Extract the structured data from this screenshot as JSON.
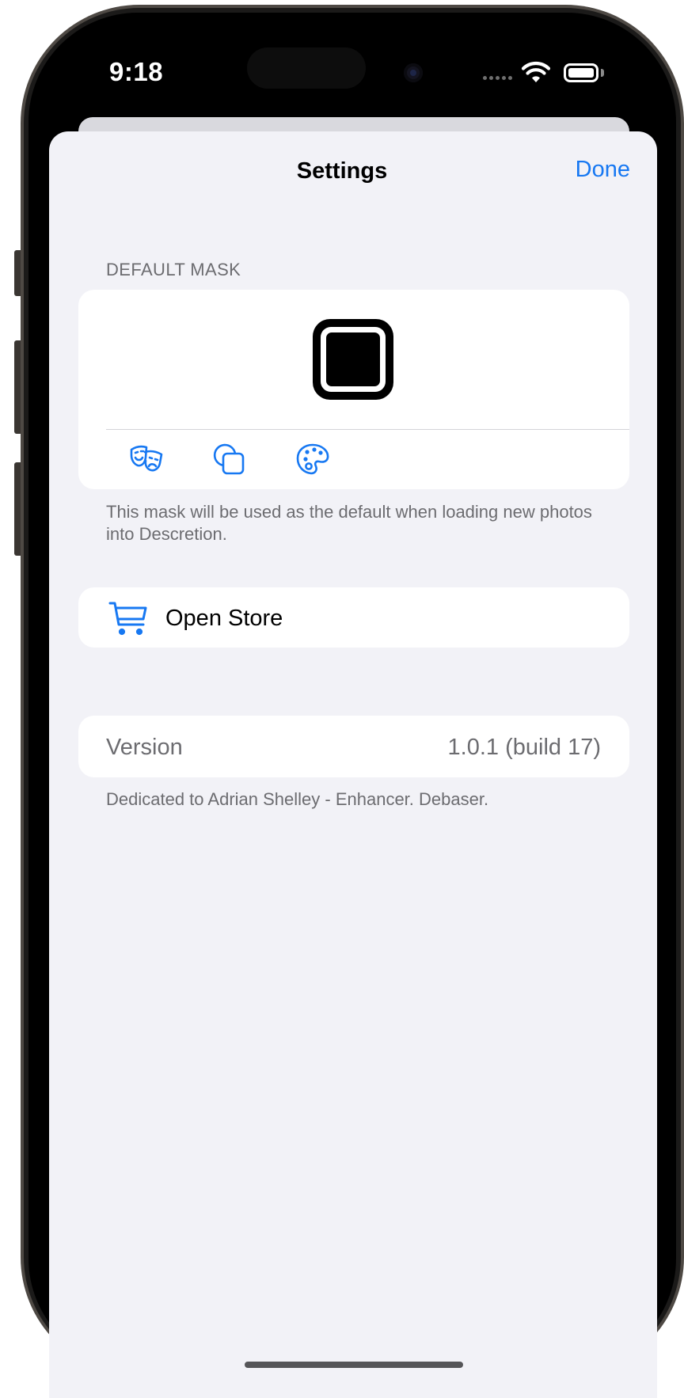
{
  "status_bar": {
    "time": "9:18",
    "icons": [
      "signal-dots-icon",
      "wifi-icon",
      "battery-icon"
    ]
  },
  "nav": {
    "title": "Settings",
    "done_label": "Done"
  },
  "default_mask": {
    "header": "DEFAULT MASK",
    "preview_icon": "square-mask-icon",
    "tools": [
      {
        "name": "theater-masks-icon"
      },
      {
        "name": "shapes-icon"
      },
      {
        "name": "palette-icon"
      }
    ],
    "footer": "This mask will be used as the default when loading new photos into Descretion."
  },
  "store": {
    "icon": "cart-icon",
    "label": "Open Store"
  },
  "about": {
    "version_label": "Version",
    "version_value": "1.0.1 (build 17)",
    "footer": "Dedicated to Adrian Shelley - Enhancer. Debaser."
  },
  "colors": {
    "accent": "#1778f2",
    "background": "#f2f2f7",
    "card": "#ffffff",
    "secondary_text": "#6c6c70"
  }
}
